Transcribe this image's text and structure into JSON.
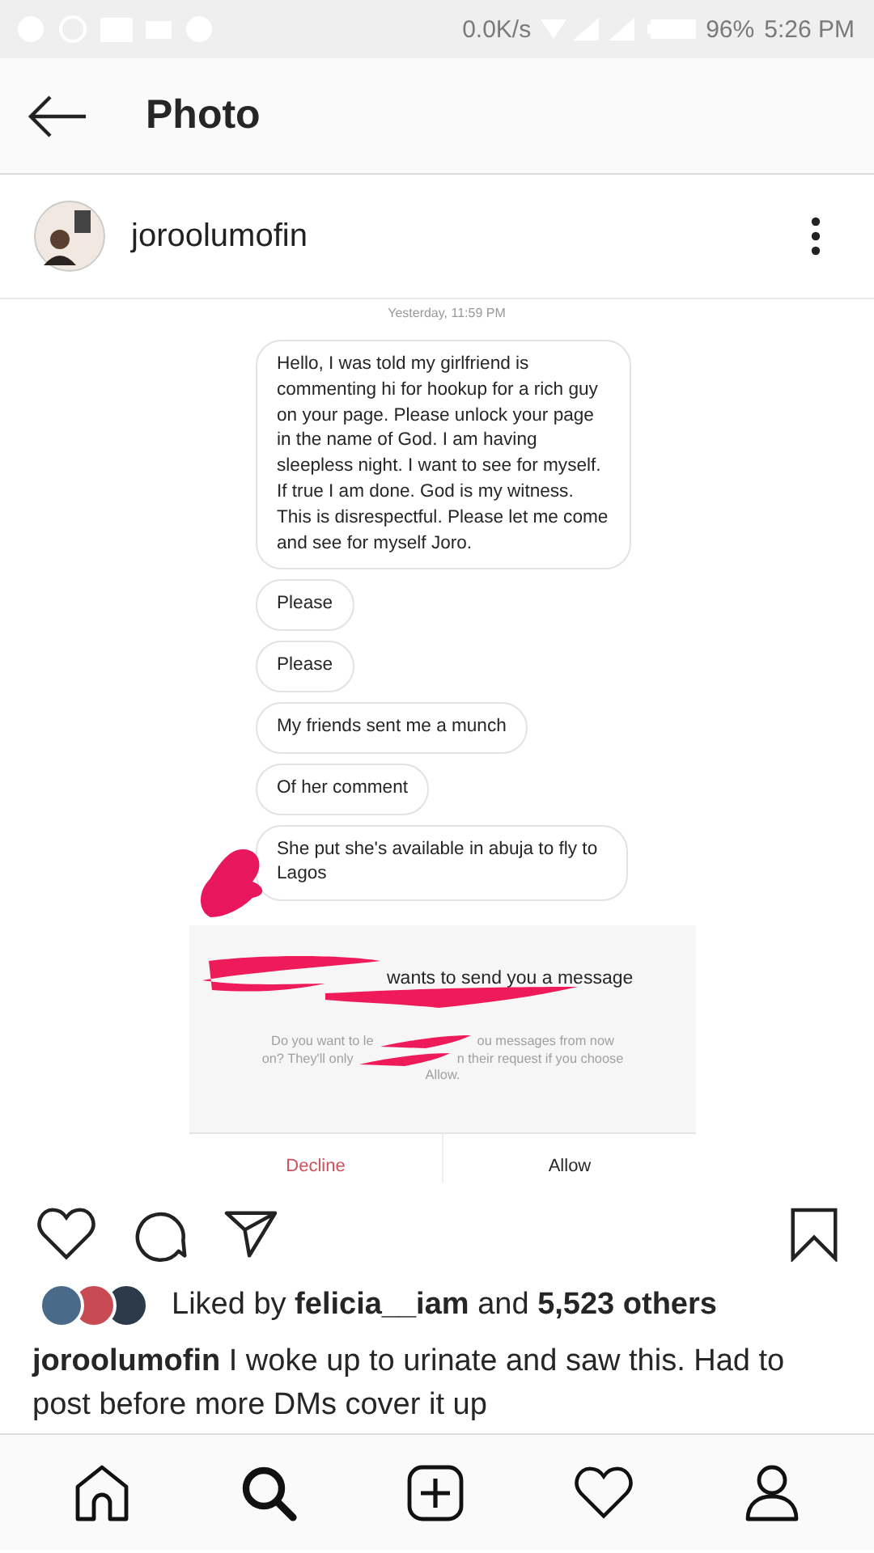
{
  "status_bar": {
    "speed": "0.0K/s",
    "battery": "96%",
    "time": "5:26 PM"
  },
  "header": {
    "title": "Photo"
  },
  "post": {
    "username": "joroolumofin"
  },
  "dm_screenshot": {
    "timestamp": "Yesterday, 11:59 PM",
    "messages": [
      {
        "text": "Hello, I was told my girlfriend is commenting hi for hookup for a rich guy on your page. Please unlock your page in the name of God. I am having sleepless night. I want to see for myself. If true I am done. God is my witness. This is disrespectful. Please let me come and see for myself Joro."
      },
      {
        "text": "Please"
      },
      {
        "text": "Please"
      },
      {
        "text": "My friends sent me a munch"
      },
      {
        "text": "Of her comment"
      },
      {
        "text": "She put she's available in abuja to fly to Lagos"
      }
    ],
    "request": {
      "title": "wants to send you a message",
      "body_lines": [
        [
          "Do you want to le",
          "ou messages from now"
        ],
        [
          "on? They'll only",
          "n their request if you choose"
        ],
        [
          "Allow."
        ]
      ]
    },
    "buttons": [
      {
        "label": "Decline",
        "kind": "destructive"
      },
      {
        "label": "Allow",
        "kind": "default"
      }
    ]
  },
  "likes": {
    "text": "Liked by **felicia__iam** and **5,523 others**"
  },
  "caption": {
    "text": "**joroolumofin** I woke up to urinate and saw this. Had to post before more DMs cover it up"
  },
  "bottom_nav": [
    {
      "kind": "home",
      "selected": false
    },
    {
      "kind": "search",
      "selected": true
    },
    {
      "kind": "add",
      "selected": false
    },
    {
      "kind": "activity",
      "selected": false
    },
    {
      "kind": "profile",
      "selected": false
    }
  ]
}
